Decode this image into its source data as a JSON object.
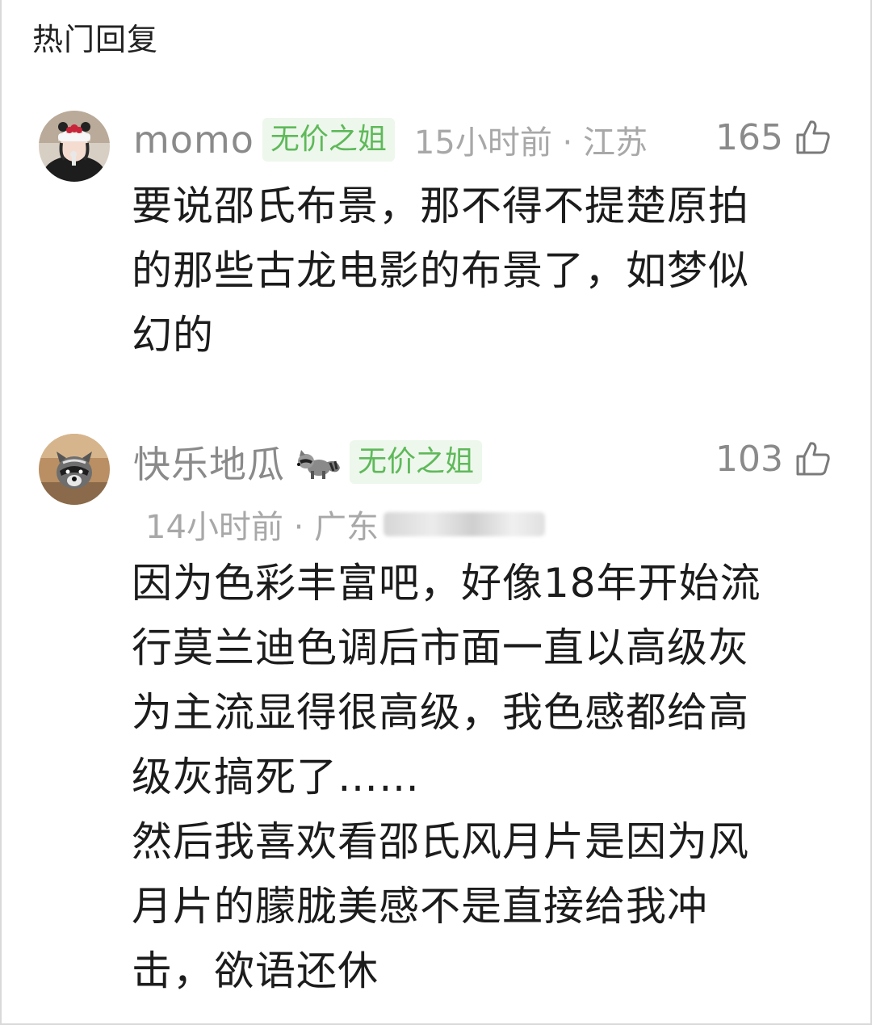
{
  "section": {
    "title": "热门回复"
  },
  "comments": [
    {
      "username": "momo",
      "badge": "无价之姐",
      "meta": "15小时前 · 江苏",
      "likes": "165",
      "content": "要说邵氏布景，那不得不提楚原拍\n的那些古龙电影的布景了，如梦似\n幻的"
    },
    {
      "username": "快乐地瓜",
      "emoji": "raccoon-icon",
      "badge": "无价之姐",
      "meta": "14小时前 · 广东",
      "likes": "103",
      "content": "因为色彩丰富吧，好像18年开始流\n行莫兰迪色调后市面一直以高级灰\n为主流显得很高级，我色感都给高\n级灰搞死了……\n然后我喜欢看邵氏风月片是因为风\n月片的朦胧美感不是直接给我冲\n击，欲语还休"
    }
  ],
  "colors": {
    "badge_text": "#5fb95a",
    "badge_bg": "#edf7ec",
    "meta_text": "#a8a8a8",
    "username_text": "#8a8a8a"
  }
}
